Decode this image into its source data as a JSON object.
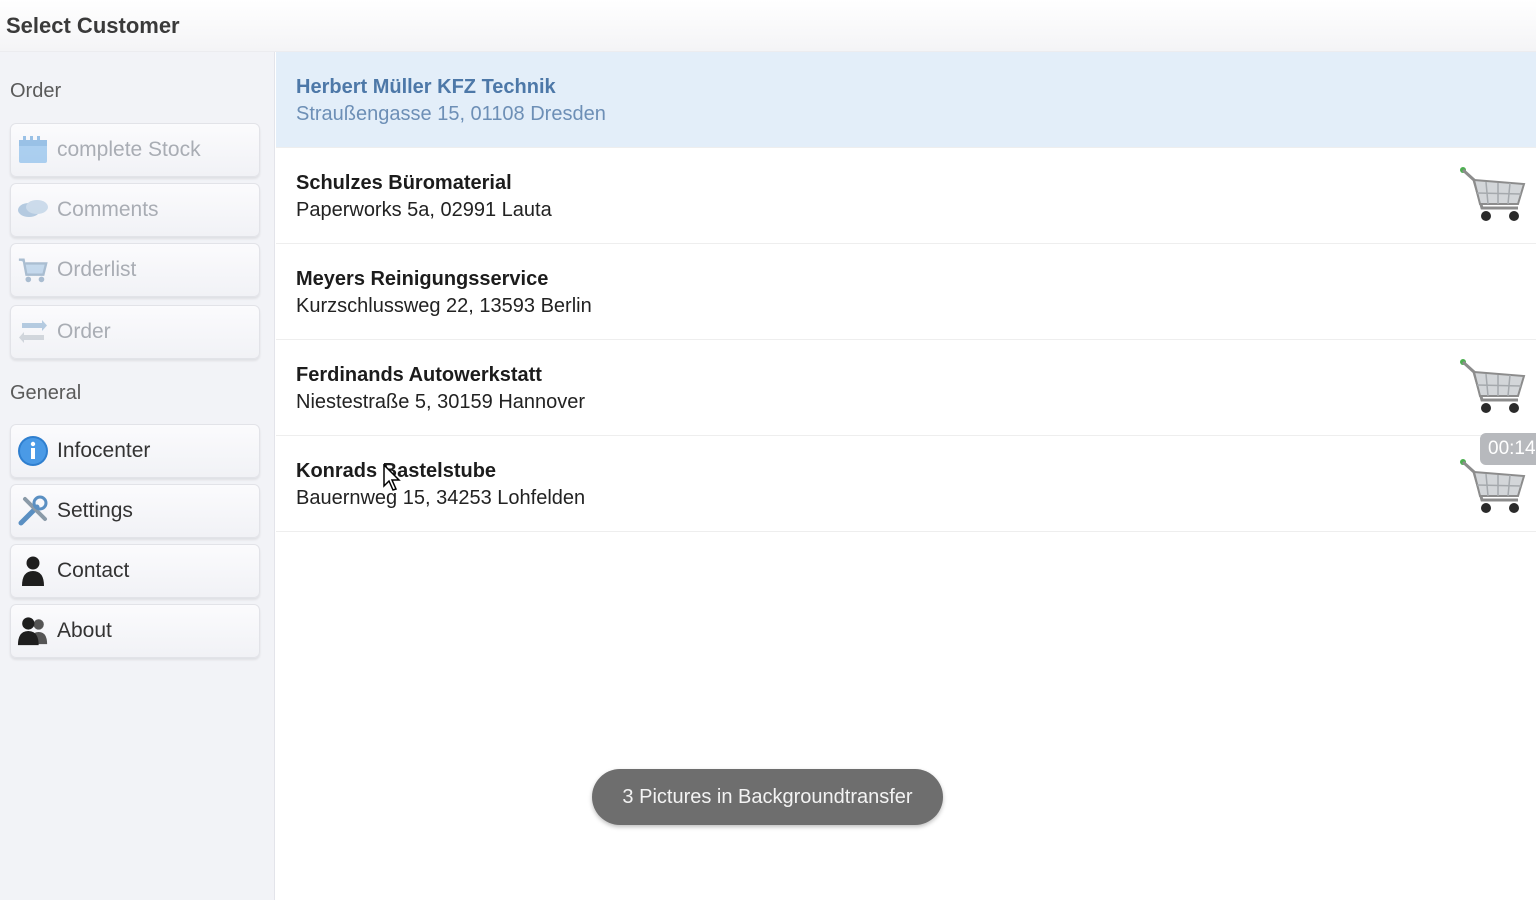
{
  "window": {
    "title": "Select Customer"
  },
  "sidebar": {
    "sections": [
      {
        "label": "Order"
      },
      {
        "label": "General"
      }
    ],
    "items": [
      {
        "label": "complete Stock",
        "icon": "stock-icon"
      },
      {
        "label": "Comments",
        "icon": "comments-icon"
      },
      {
        "label": "Orderlist",
        "icon": "cart-icon"
      },
      {
        "label": "Order",
        "icon": "transfer-icon"
      },
      {
        "label": "Infocenter",
        "icon": "info-icon"
      },
      {
        "label": "Settings",
        "icon": "tools-icon"
      },
      {
        "label": "Contact",
        "icon": "person-icon"
      },
      {
        "label": "About",
        "icon": "people-icon"
      }
    ]
  },
  "customers": [
    {
      "name": "Herbert Müller KFZ Technik",
      "address": "Straußengasse 15, 01108 Dresden"
    },
    {
      "name": "Schulzes Büromaterial",
      "address": "Paperworks 5a, 02991 Lauta"
    },
    {
      "name": "Meyers Reinigungsservice",
      "address": "Kurzschlussweg 22, 13593 Berlin"
    },
    {
      "name": "Ferdinands Autowerkstatt",
      "address": "Niestestraße 5, 30159 Hannover"
    },
    {
      "name": "Konrads Bastelstube",
      "address": "Bauernweg 15, 34253 Lohfelden"
    }
  ],
  "timer": "00:14",
  "toast": "3 Pictures in Backgroundtransfer",
  "colors": {
    "selected_row": "#e3eef9",
    "selected_text": "#4d78a8",
    "toast_bg": "#6e6e6e"
  }
}
